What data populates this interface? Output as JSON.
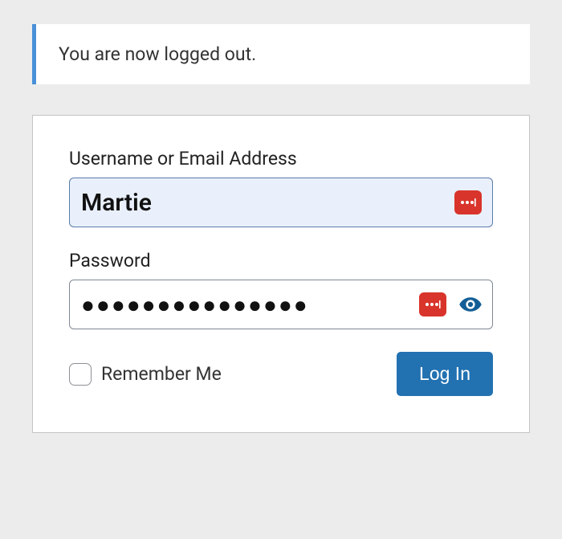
{
  "notice": {
    "message": "You are now logged out."
  },
  "form": {
    "username": {
      "label": "Username or Email Address",
      "value": "Martie"
    },
    "password": {
      "label": "Password",
      "value": "●●●●●●●●●●●●●●●"
    },
    "remember": {
      "label": "Remember Me"
    },
    "submit": {
      "label": "Log In"
    }
  },
  "icons": {
    "password_manager": "password-manager-icon",
    "show_password": "eye-icon"
  }
}
